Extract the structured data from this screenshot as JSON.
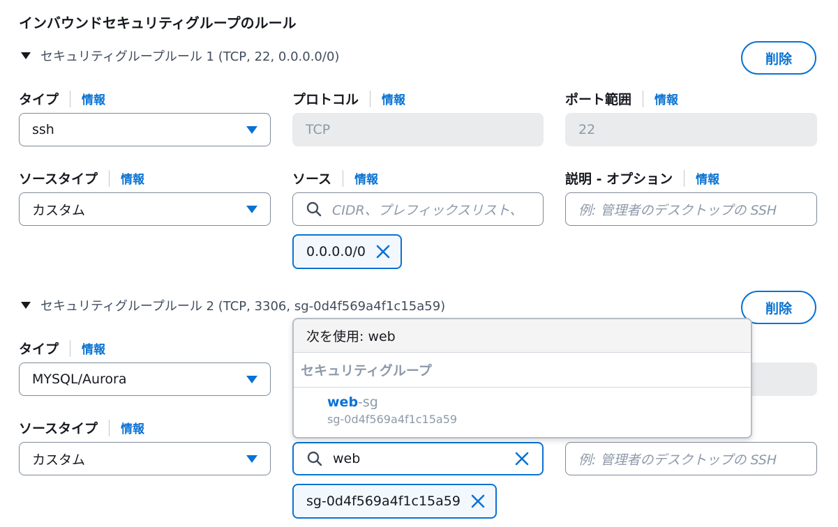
{
  "page_title": "インバウンドセキュリティグループのルール",
  "labels": {
    "type": "タイプ",
    "protocol": "プロトコル",
    "port_range": "ポート範囲",
    "source_type": "ソースタイプ",
    "source": "ソース",
    "description": "説明 - オプション",
    "info": "情報"
  },
  "delete_label": "削除",
  "rules": [
    {
      "title": "セキュリティグループルール 1 (TCP, 22, 0.0.0.0/0)",
      "type_value": "ssh",
      "protocol_value": "TCP",
      "port_value": "22",
      "source_type_value": "カスタム",
      "source_placeholder": "CIDR、プレフィックスリスト、",
      "description_placeholder": "例: 管理者のデスクトップの SSH",
      "source_token": "0.0.0.0/0"
    },
    {
      "title": "セキュリティグループルール 2 (TCP, 3306, sg-0d4f569a4f1c15a59)",
      "type_value": "MYSQL/Aurora",
      "source_type_value": "カスタム",
      "source_search_value": "web",
      "description_placeholder": "例: 管理者のデスクトップの SSH",
      "source_token": "sg-0d4f569a4f1c15a59"
    }
  ],
  "dropdown": {
    "use_text": "次を使用: web",
    "group_label": "セキュリティグループ",
    "option": {
      "name_match": "web",
      "name_rest": "-sg",
      "description": "sg-0d4f569a4f1c15a59"
    }
  },
  "colors": {
    "accent": "#0972d3",
    "disabled_bg": "#e9ebed",
    "muted_text": "#8d99a8",
    "token_bg": "#f2f8fd"
  },
  "icons": {
    "search": "search-icon",
    "remove": "close-icon",
    "expand": "caret-down-icon",
    "select": "triangle-down-icon"
  }
}
